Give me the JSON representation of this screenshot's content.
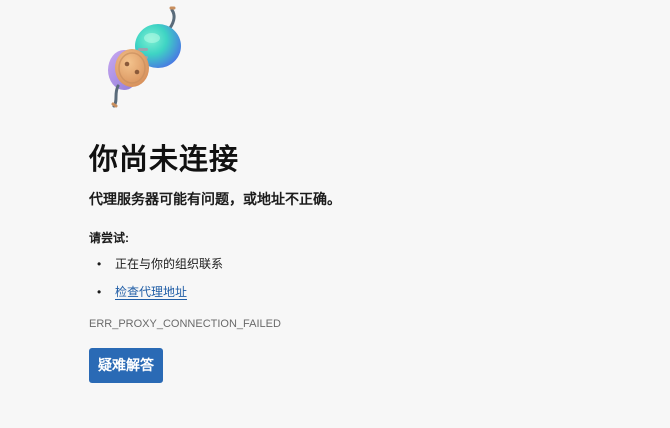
{
  "illustration": {
    "icon": "disconnected-plug-illustration",
    "colors": {
      "plug_head": "#e6a86f",
      "plug_rim": "#c98f5e",
      "socket_side": "#b9a0e8",
      "orb_teal": "#3ed4c4",
      "orb_blue": "#4a7ee8",
      "cable": "#5a6b7a"
    }
  },
  "title": "你尚未连接",
  "subtitle": "代理服务器可能有问题，或地址不正确。",
  "try_label": "请尝试:",
  "suggestions": [
    {
      "bullet": "•",
      "text": "正在与你的组织联系",
      "is_link": false
    },
    {
      "bullet": "•",
      "text": "检查代理地址",
      "is_link": true
    }
  ],
  "error_code": "ERR_PROXY_CONNECTION_FAILED",
  "button": {
    "label": "疑难解答",
    "color": "#2a6ab5"
  },
  "link_color": "#1f5da6",
  "background_color": "#f7f7f7"
}
